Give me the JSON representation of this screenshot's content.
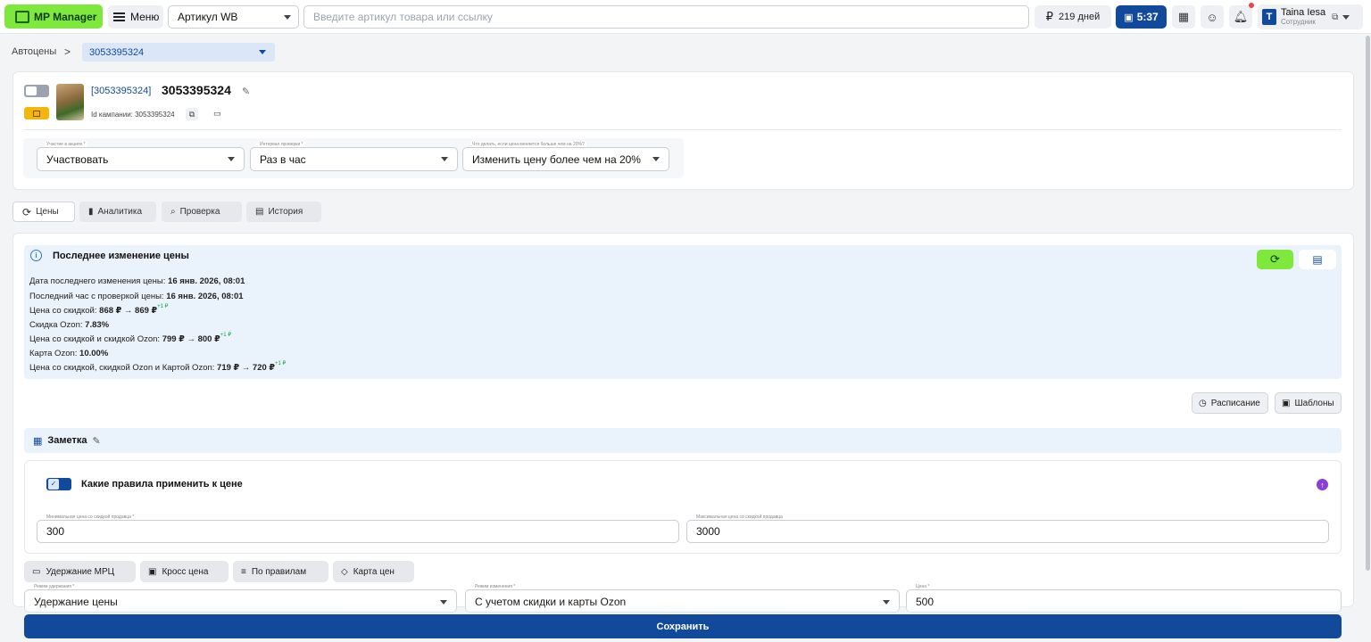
{
  "header": {
    "logo_label": "MP Manager",
    "menu_label": "Меню",
    "article_select": "Артикул WB",
    "search_placeholder": "Введите артикул товара или ссылку",
    "days_label": "219 дней",
    "timer_label": "5:37",
    "user": {
      "initial": "T",
      "name": "Taina Iesa",
      "role": "Сотрудник"
    }
  },
  "breadcrumb": {
    "root": "Автоцены",
    "separator": ">",
    "current": "3053395324"
  },
  "product": {
    "link": "[3053395324]",
    "title": "3053395324",
    "campaign": "Id кампании: 3053395324"
  },
  "filters": [
    {
      "label": "Участие в акциях *",
      "value": "Участвовать"
    },
    {
      "label": "Интервал проверки *",
      "value": "Раз в час"
    },
    {
      "label": "Что делать, если цена меняется больше чем на 20%?",
      "value": "Изменить цену более чем на 20%"
    }
  ],
  "tabs": [
    {
      "label": "Цены",
      "icon": "price-change-icon"
    },
    {
      "label": "Аналитика",
      "icon": "bar-chart-icon"
    },
    {
      "label": "Проверка",
      "icon": "search-icon"
    },
    {
      "label": "История",
      "icon": "book-icon"
    }
  ],
  "last_change": {
    "title": "Последнее изменение цены",
    "date_label": "Дата последнего изменения цены:",
    "date_value": "16 янв. 2026, 08:01",
    "hour_label": "Последний час с проверкой цены:",
    "hour_value": "16 янв. 2026, 08:01",
    "discount_price_label": "Цена со скидкой:",
    "discount_price_value": "868 ₽ → 869 ₽",
    "discount_price_delta": "+1 ₽",
    "ozon_discount_label": "Скидка Ozon:",
    "ozon_discount_value": "7.83%",
    "ozon_price_label": "Цена со скидкой и скидкой Ozon:",
    "ozon_price_value": "799 ₽ → 800 ₽",
    "ozon_price_delta": "+1 ₽",
    "card_label": "Карта Ozon:",
    "card_value": "10.00%",
    "card_price_label": "Цена со скидкой, скидкой Ozon и Картой Ozon:",
    "card_price_value": "719 ₽ → 720 ₽",
    "card_price_delta": "+1 ₽"
  },
  "actions": {
    "schedule": "Расписание",
    "templates": "Шаблоны"
  },
  "note": {
    "label": "Заметка"
  },
  "rules": {
    "title": "Какие правила применить к цене",
    "min_label": "Минимальная цена со скидкой продавца *",
    "min_value": "300",
    "max_label": "Максимальная цена со скидкой продавца",
    "max_value": "3000"
  },
  "modes": [
    {
      "label": "Удержание МРЦ"
    },
    {
      "label": "Кросс цена"
    },
    {
      "label": "По правилам"
    },
    {
      "label": "Карта цен"
    }
  ],
  "bottom_fields": [
    {
      "label": "Режим удержания *",
      "value": "Удержание цены"
    },
    {
      "label": "Режим изменения *",
      "value": "С учетом скидки и карты Ozon"
    },
    {
      "label": "Цена *",
      "value": "500"
    }
  ],
  "save_label": "Сохранить",
  "colors": {
    "brand_green": "#7ee83c",
    "brand_blue": "#124a9b",
    "info_bg": "#eaf2fb"
  }
}
